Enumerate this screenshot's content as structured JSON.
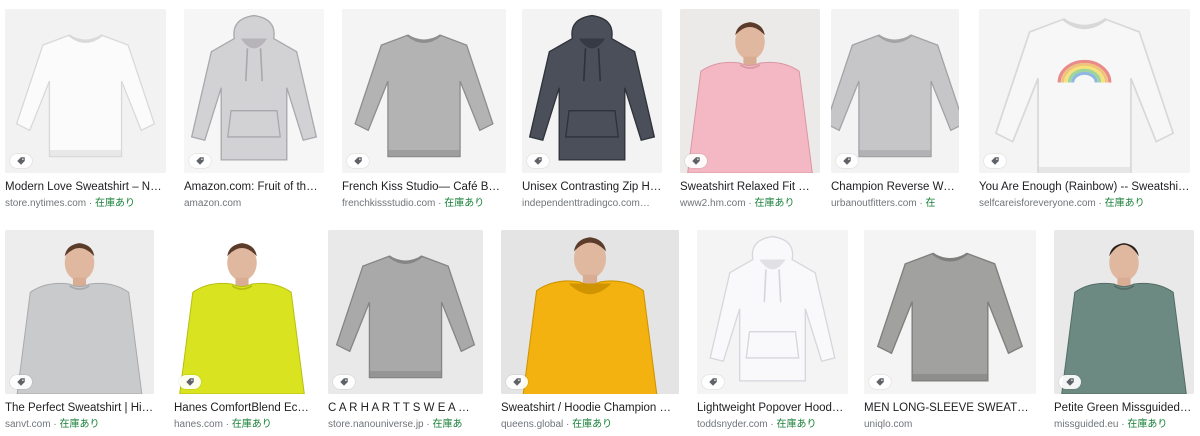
{
  "colors": {
    "title": "#202124",
    "source": "#70757a",
    "in_stock": "#188038"
  },
  "results": [
    {
      "title": "Modern Love Sweatshirt – N…",
      "source": "store.nytimes.com",
      "stock": "在庫あり",
      "icon": "tag-icon",
      "product": "white crewneck sweatshirt",
      "bg": "#f2f2f2",
      "body": "#fbfbfb",
      "shade": "#d9d9d9",
      "shape": "crew",
      "model": false
    },
    {
      "title": "Amazon.com: Fruit of th…",
      "source": "amazon.com",
      "stock": "",
      "icon": "tag-icon",
      "product": "light grey hoodie",
      "bg": "#f6f6f6",
      "body": "#d2d1d4",
      "shade": "#a9a8ac",
      "shape": "hoodie",
      "model": false
    },
    {
      "title": "French Kiss Studio— Café Bo…",
      "source": "frenchkissstudio.com",
      "stock": "在庫あり",
      "icon": "tag-icon",
      "product": "grey crewneck sweatshirt",
      "bg": "#f4f4f4",
      "body": "#b3b3b3",
      "shade": "#8d8d8d",
      "shape": "crew",
      "model": false
    },
    {
      "title": "Unisex Contrasting Zip H…",
      "source": "independenttradingco.com…",
      "stock": "",
      "icon": "tag-icon",
      "product": "charcoal hoodie",
      "bg": "#f3f3f3",
      "body": "#4a4f5a",
      "shade": "#2e323a",
      "shape": "hoodie",
      "model": false
    },
    {
      "title": "Sweatshirt Relaxed Fit …",
      "source": "www2.hm.com",
      "stock": "在庫あり",
      "icon": "tag-icon",
      "product": "pink sweatshirt on model",
      "bg": "#eceae8",
      "body": "#f3b8c3",
      "shade": "#d996a3",
      "shape": "model",
      "model": true
    },
    {
      "title": "Champion Reverse We…",
      "source": "urbanoutfitters.com",
      "stock": "在",
      "icon": "tag-icon",
      "product": "grey champion sweatshirt",
      "bg": "#f3f3f3",
      "body": "#c6c6c8",
      "shade": "#a3a3a6",
      "shape": "crew",
      "model": false
    },
    {
      "title": "You Are Enough (Rainbow) -- Sweatshir…",
      "source": "selfcareisforeveryone.com",
      "stock": "在庫あり",
      "icon": "tag-icon",
      "product": "white sweatshirt with rainbow",
      "bg": "#f4f4f4",
      "body": "#f7f7f7",
      "shade": "#d8d8d8",
      "shape": "rainbow",
      "model": false
    },
    {
      "title": "The Perfect Sweatshirt | Hi…",
      "source": "sanvt.com",
      "stock": "在庫あり",
      "icon": "tag-icon",
      "product": "light grey sweatshirt on model",
      "bg": "#ededed",
      "body": "#c9cacc",
      "shade": "#a8a9ab",
      "shape": "model",
      "model": true
    },
    {
      "title": "Hanes ComfortBlend Ec…",
      "source": "hanes.com",
      "stock": "在庫あり",
      "icon": "tag-icon",
      "product": "lime sweatshirt on model",
      "bg": "#ffffff",
      "body": "#d9e31f",
      "shade": "#b6bf10",
      "shape": "model",
      "model": true
    },
    {
      "title": "C A R H A R T T S W E A …",
      "source": "store.nanouniverse.jp",
      "stock": "在庫あ",
      "icon": "tag-icon",
      "product": "grey carhartt sweatshirt",
      "bg": "#e9e9e9",
      "body": "#a9a9a9",
      "shade": "#858585",
      "shape": "crew",
      "model": false
    },
    {
      "title": "Sweatshirt / Hoodie Champion …",
      "source": "queens.global",
      "stock": "在庫あり",
      "icon": "tag-icon",
      "product": "yellow hoodie on model",
      "bg": "#e4e4e4",
      "body": "#f3b20f",
      "shade": "#cf9400",
      "shape": "model-hood",
      "model": true
    },
    {
      "title": "Lightweight Popover Hood…",
      "source": "toddsnyder.com",
      "stock": "在庫あり",
      "icon": "tag-icon",
      "product": "white hoodie",
      "bg": "#f4f4f4",
      "body": "#f9f9fb",
      "shade": "#d6d6dc",
      "shape": "hoodie",
      "model": false
    },
    {
      "title": "MEN LONG-SLEEVE SWEATSHI…",
      "source": "uniqlo.com",
      "stock": "",
      "icon": "tag-icon",
      "product": "heather grey sweatshirt",
      "bg": "#f4f4f4",
      "body": "#a1a29f",
      "shade": "#7f807d",
      "shape": "crew",
      "model": false
    },
    {
      "title": "Petite Green Missguided…",
      "source": "missguided.eu",
      "stock": "在庫あり",
      "icon": "tag-icon",
      "product": "green sweatshirt on model",
      "bg": "#e9e9e9",
      "body": "#6d8a82",
      "shade": "#536c65",
      "shape": "model-f",
      "model": true
    }
  ]
}
